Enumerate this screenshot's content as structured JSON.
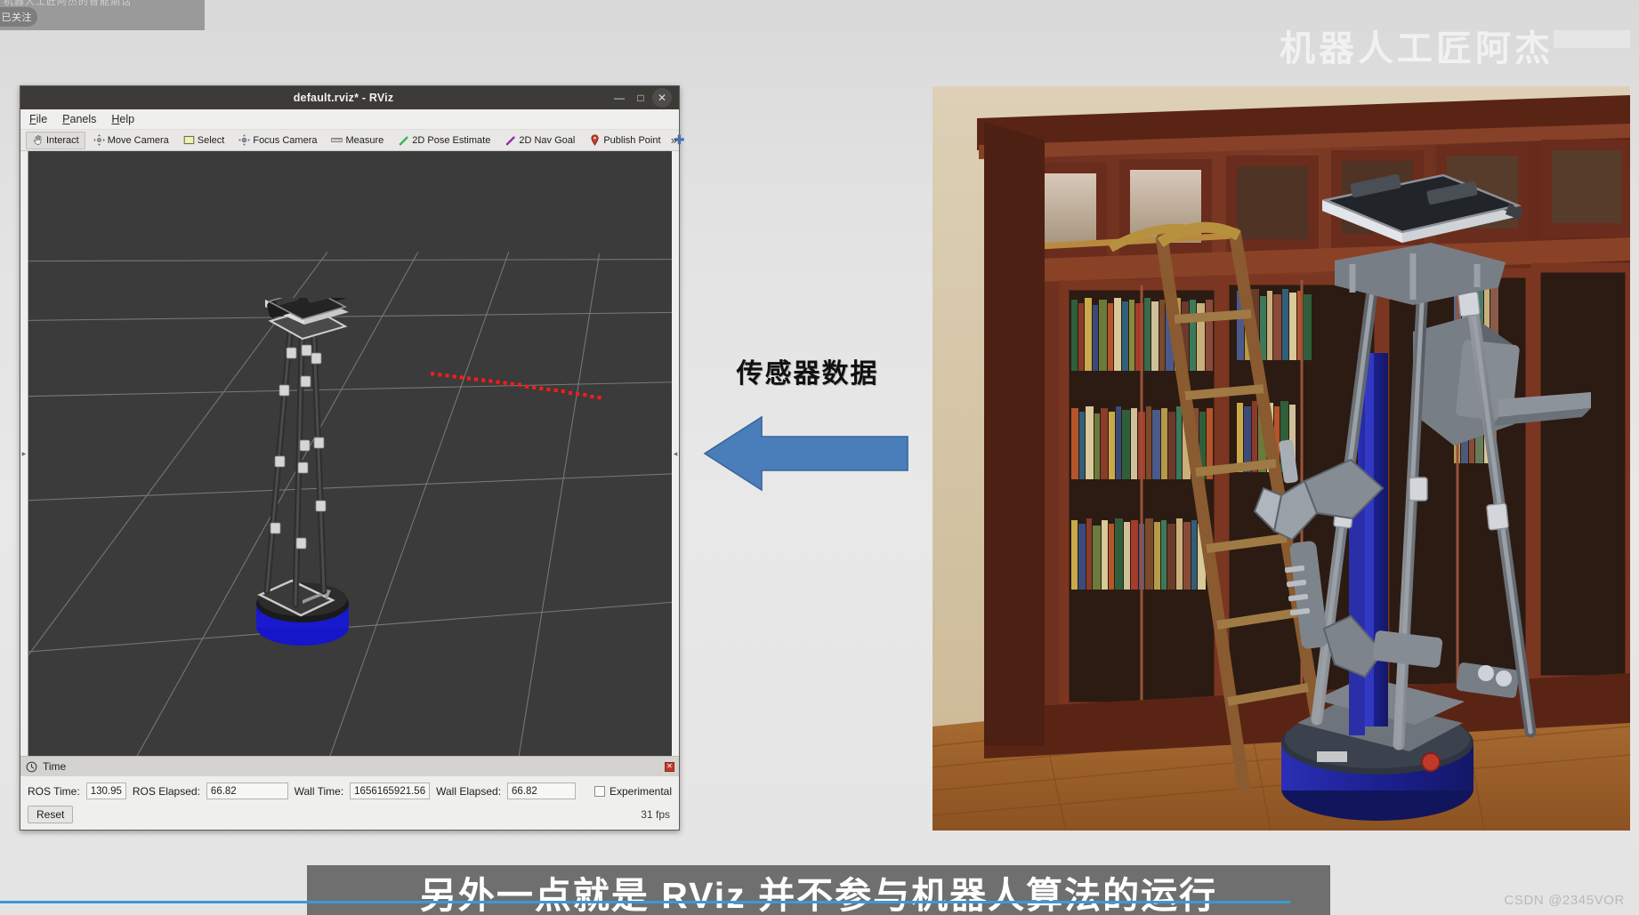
{
  "overlay": {
    "top_strip_text": "机器人工匠阿杰的智能期话",
    "follow_label": "已关注",
    "watermark": "机器人工匠阿杰",
    "csdn": "CSDN @2345VOR"
  },
  "rviz": {
    "title": "default.rviz* - RViz",
    "window_buttons": {
      "minimize": "—",
      "maximize": "□",
      "close": "✕"
    },
    "menu": [
      {
        "name": "file",
        "mnemonic": "F",
        "rest": "ile"
      },
      {
        "name": "panels",
        "mnemonic": "P",
        "rest": "anels"
      },
      {
        "name": "help",
        "mnemonic": "H",
        "rest": "elp"
      }
    ],
    "toolbar": {
      "overflow": "»",
      "plus": "✚",
      "buttons": [
        {
          "name": "interact",
          "label": "Interact",
          "icon": "hand-icon",
          "active": true
        },
        {
          "name": "move-camera",
          "label": "Move Camera",
          "icon": "move-camera-icon",
          "active": false
        },
        {
          "name": "select",
          "label": "Select",
          "icon": "select-rect-icon",
          "active": false
        },
        {
          "name": "focus-camera",
          "label": "Focus Camera",
          "icon": "focus-camera-icon",
          "active": false
        },
        {
          "name": "measure",
          "label": "Measure",
          "icon": "ruler-icon",
          "active": false
        },
        {
          "name": "pose-estimate",
          "label": "2D Pose Estimate",
          "icon": "green-arrow-icon",
          "active": false
        },
        {
          "name": "nav-goal",
          "label": "2D Nav Goal",
          "icon": "purple-arrow-icon",
          "active": false
        },
        {
          "name": "publish-point",
          "label": "Publish Point",
          "icon": "map-pin-icon",
          "active": false
        }
      ]
    },
    "viewport": {
      "background_color": "#3b3b3b",
      "grid_color": "#9a9a9a",
      "laser_scan_color": "#ff1111",
      "robot_base_color": "#1616c8"
    },
    "time_panel": {
      "header_label": "Time",
      "header_icon": "clock-icon",
      "fields": [
        {
          "name": "ros-time",
          "label": "ROS Time:",
          "value": "130.95"
        },
        {
          "name": "ros-elapsed",
          "label": "ROS Elapsed:",
          "value": "66.82"
        },
        {
          "name": "wall-time",
          "label": "Wall Time:",
          "value": "1656165921.56"
        },
        {
          "name": "wall-elapsed",
          "label": "Wall Elapsed:",
          "value": "66.82"
        }
      ],
      "experimental_label": "Experimental",
      "experimental_checked": false,
      "reset_label": "Reset",
      "fps_label": "31 fps"
    }
  },
  "annotation": {
    "label": "传感器数据",
    "arrow_direction": "left",
    "arrow_color": "#4a7ebb"
  },
  "photo": {
    "alt": "Mobile manipulator robot in front of a wooden bookcase with a ladder",
    "floor_color": "#b5762f",
    "bookcase_color": "#6b2d1d",
    "robot_base_color": "#1f2aa0"
  },
  "subtitle": {
    "text": "另外一点就是 RViz 并不参与机器人算法的运行"
  }
}
